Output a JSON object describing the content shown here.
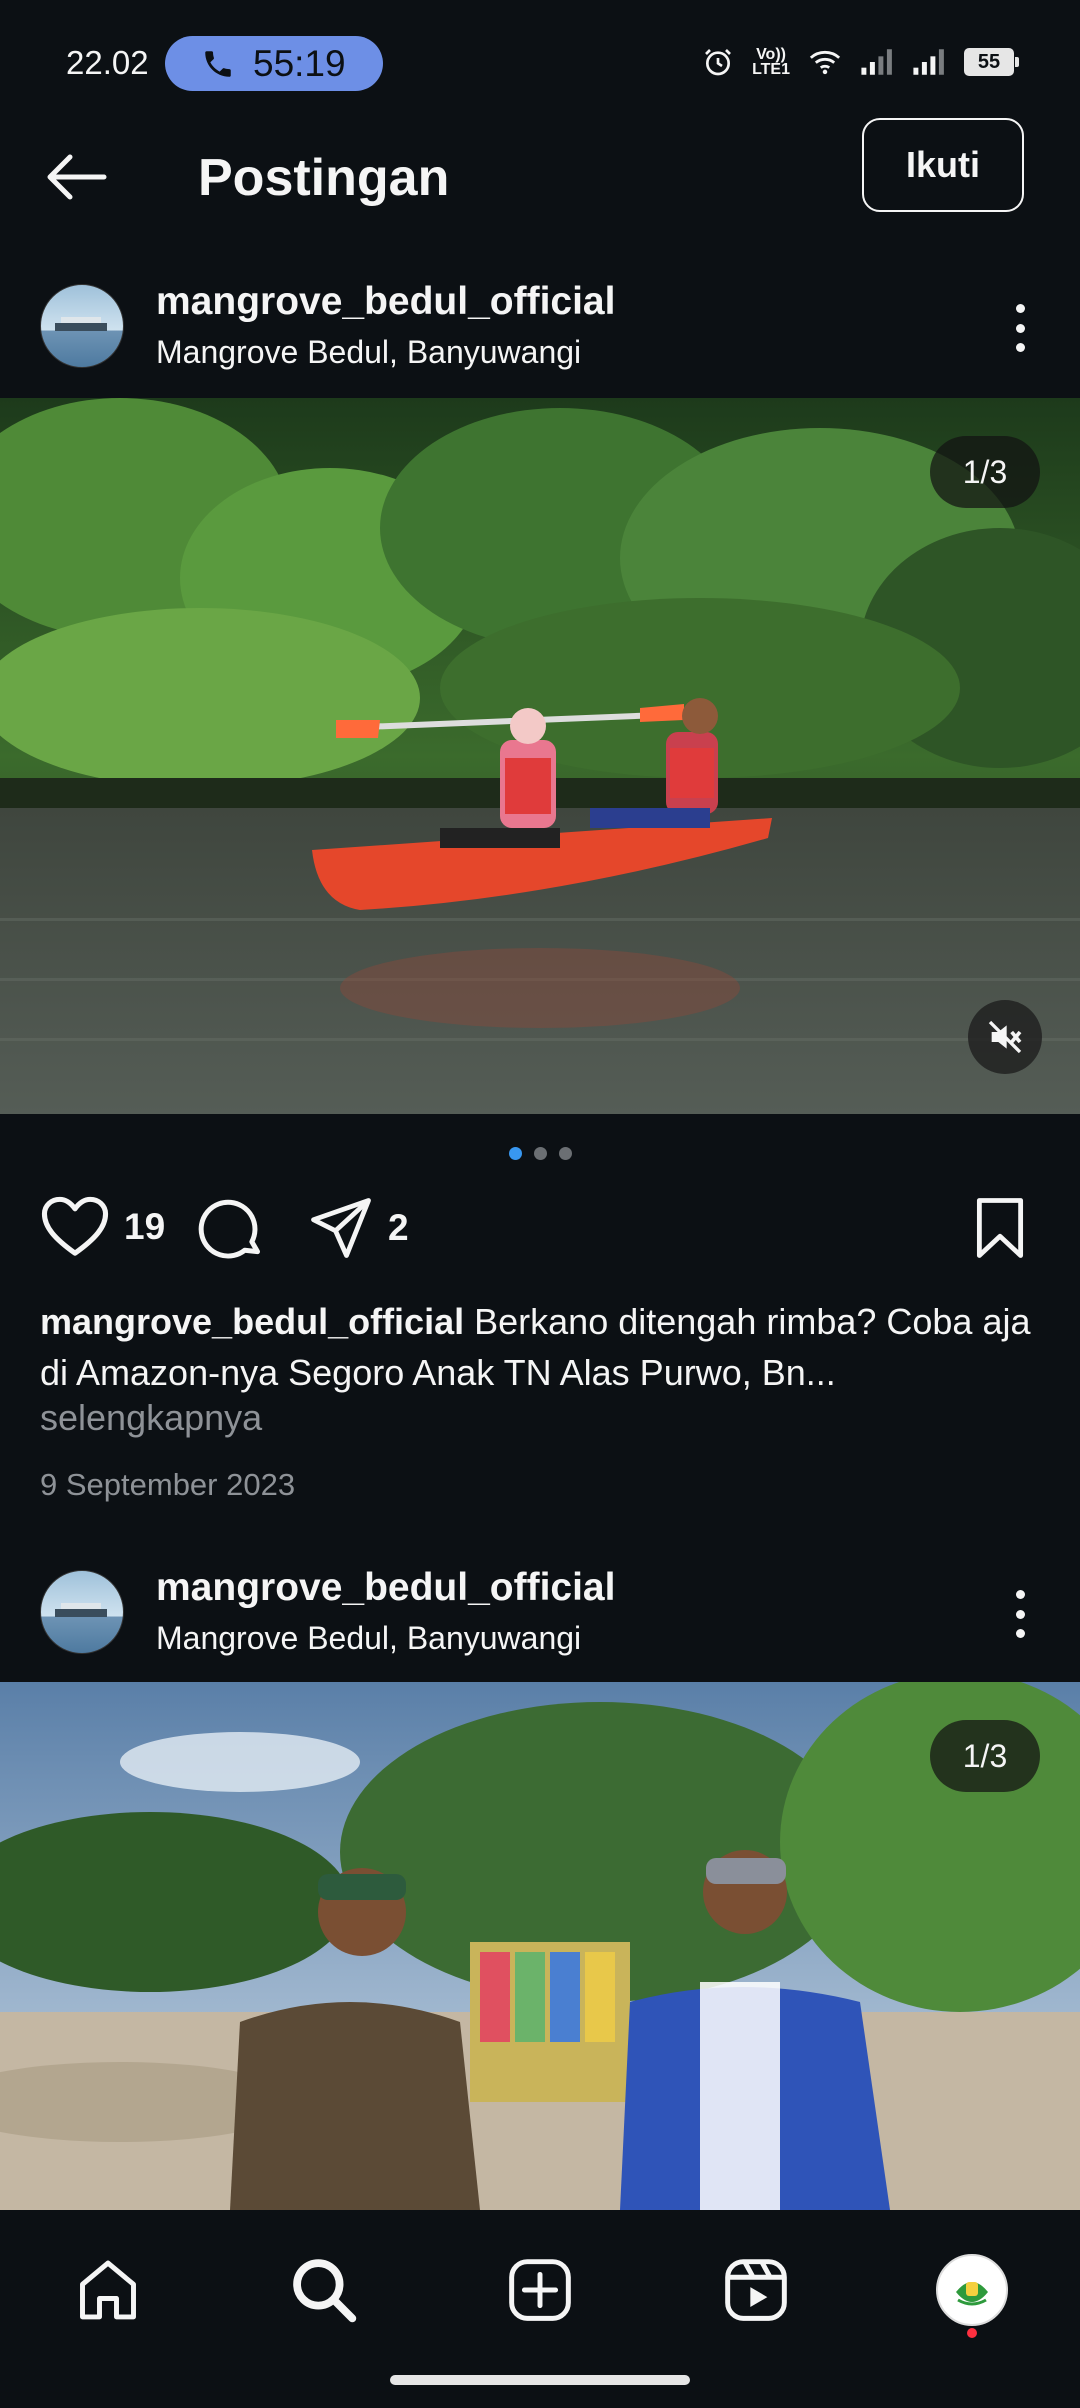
{
  "status_bar": {
    "time": "22.02",
    "call_timer": "55:19",
    "volte_top": "Vo))",
    "volte_bottom": "LTE1",
    "battery": "55"
  },
  "header": {
    "title": "Postingan",
    "follow_label": "Ikuti"
  },
  "posts": [
    {
      "username": "mangrove_bedul_official",
      "location": "Mangrove Bedul, Banyuwangi",
      "counter": "1/3"
    },
    {
      "username": "mangrove_bedul_official",
      "location": "Mangrove Bedul, Banyuwangi",
      "counter": "1/3"
    }
  ],
  "actions": {
    "likes": "19",
    "shares": "2"
  },
  "caption": {
    "username": "mangrove_bedul_official",
    "text": "Berkano ditengah rimba? Coba aja di Amazon-nya Segoro Anak TN Alas Purwo, Bn...",
    "more": "selengkapnya",
    "date": "9 September 2023"
  },
  "carousel": {
    "total": 3,
    "active": 1
  },
  "icons": {
    "back": "arrow-left-icon",
    "more": "more-vertical-icon",
    "like": "heart-icon",
    "comment": "comment-icon",
    "share": "send-icon",
    "save": "bookmark-icon",
    "mute": "speaker-muted-icon",
    "home": "home-icon",
    "search": "search-icon",
    "create": "plus-square-icon",
    "reels": "reels-icon",
    "profile": "profile-avatar"
  },
  "colors": {
    "background": "#0c1014",
    "accent": "#3897f0",
    "call_pill": "#6d8fe6",
    "notification": "#ff3040"
  }
}
